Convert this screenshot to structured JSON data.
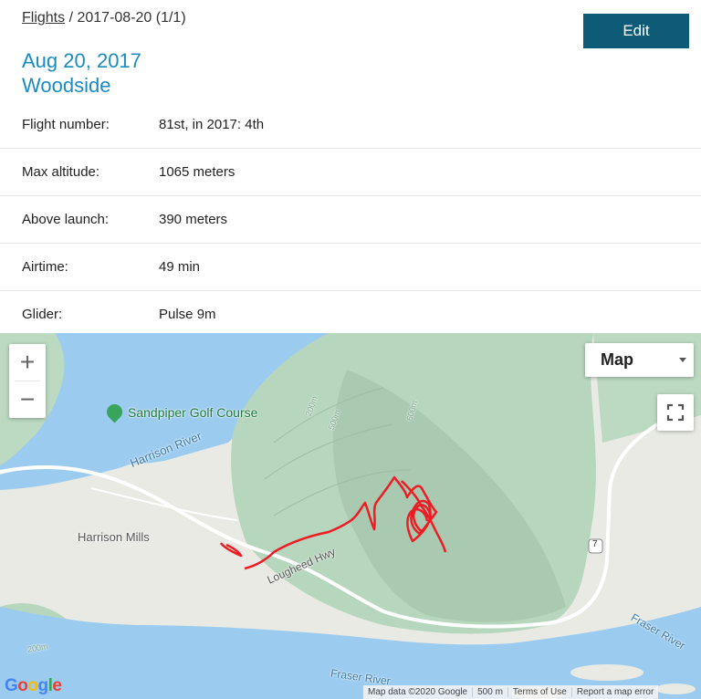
{
  "breadcrumb": {
    "link": "Flights",
    "sep": " / ",
    "current": "2017-08-20 (1/1)"
  },
  "edit_label": "Edit",
  "title": {
    "date": "Aug 20, 2017",
    "site": "Woodside"
  },
  "details": [
    {
      "label": "Flight number:",
      "value": "81st, in 2017: 4th"
    },
    {
      "label": "Max altitude:",
      "value": "1065 meters"
    },
    {
      "label": "Above launch:",
      "value": "390 meters"
    },
    {
      "label": "Airtime:",
      "value": "49 min"
    },
    {
      "label": "Glider:",
      "value": "Pulse 9m"
    }
  ],
  "map": {
    "zoom_in": "+",
    "zoom_out": "−",
    "map_type": "Map",
    "labels": {
      "golf": "Sandpiper Golf Course",
      "harrison_river": "Harrison River",
      "harrison_mills": "Harrison Mills",
      "lougheed": "Lougheed Hwy",
      "fraser_river": "Fraser River",
      "fraser_river_bottom": "Fraser River",
      "hwy": "7",
      "contour_200": "200m",
      "contour_500": "500m",
      "contour_600": "600m",
      "contour_200b": "200m"
    },
    "footer": {
      "data": "Map data ©2020 Google",
      "scale": "500 m",
      "terms": "Terms of Use",
      "report": "Report a map error"
    },
    "google_logo": "Google",
    "colors": {
      "water": "#9ccbf0",
      "land": "#e8eae3",
      "forest": "#bcd9c2",
      "track": "#ee1c24"
    }
  }
}
